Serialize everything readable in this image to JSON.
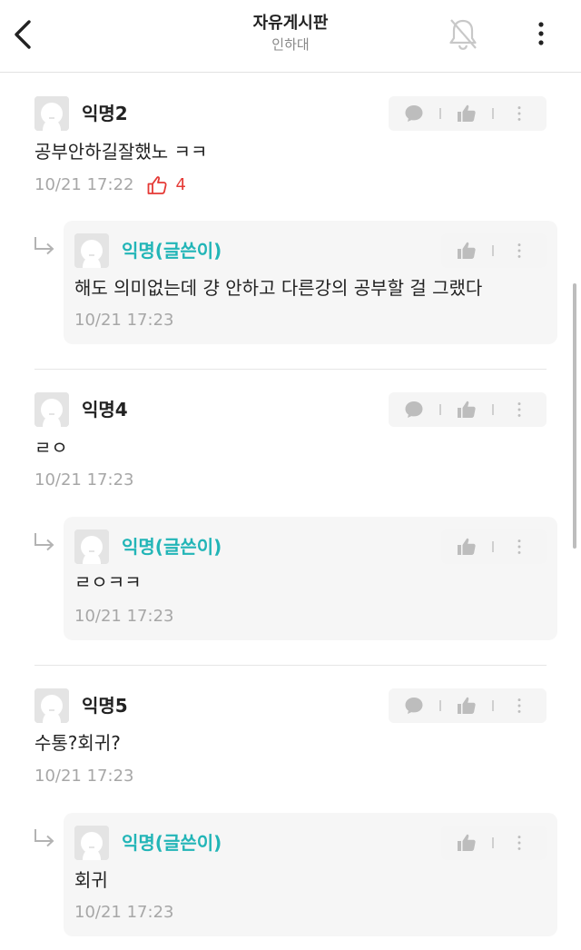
{
  "header": {
    "title": "자유게시판",
    "subtitle": "인하대",
    "icons": {
      "back": "back-arrow-icon",
      "bell": "bell-off-icon",
      "more": "more-vertical-icon"
    }
  },
  "colors": {
    "op_author": "#22b5b7",
    "like_red": "#e53935",
    "meta_gray": "#a7a7a7"
  },
  "comments": [
    {
      "author": "익명2",
      "text": "공부안하길잘했노 ㅋㅋ",
      "time": "10/21 17:22",
      "likes": "4",
      "reply": {
        "author": "익명(글쓴이)",
        "text": "해도 의미없는데 걍 안하고 다른강의 공부할 걸 그랬다",
        "time": "10/21 17:23"
      }
    },
    {
      "author": "익명4",
      "text": "ㄹㅇ",
      "time": "10/21 17:23",
      "reply": {
        "author": "익명(글쓴이)",
        "text": "ㄹㅇㅋㅋ",
        "time": "10/21 17:23"
      }
    },
    {
      "author": "익명5",
      "text": "수통?회귀?",
      "time": "10/21 17:23",
      "reply": {
        "author": "익명(글쓴이)",
        "text": "회귀",
        "time": "10/21 17:23"
      }
    }
  ]
}
